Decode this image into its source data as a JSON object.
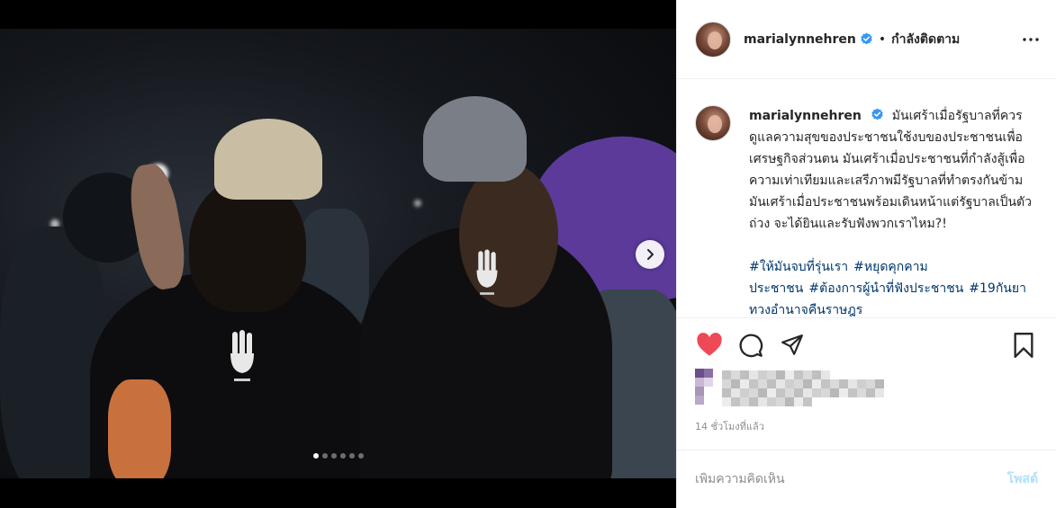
{
  "post": {
    "username": "marialynnehren",
    "follow_status": "กำลังติดตาม",
    "separator": "•",
    "caption": "มันเศร้าเมื่อรัฐบาลที่ควรดูแลความสุขของประชาชนใช้งบของประชาชนเพื่อเศรษฐกิจส่วนตน มันเศร้าเมื่อประชาชนที่กำลังสู้เพื่อความเท่าเทียมและเสรีภาพมีรัฐบาลที่ทำตรงกันข้าม มันเศร้าเมื่อประชาชนพร้อมเดินหน้าแต่รัฐบาลเป็นตัวถ่วง จะได้ยินและรับฟังพวกเราไหม?!",
    "hashtags": [
      "#ให้มันจบที่รุ่นเรา",
      "#หยุดคุกคามประชาชน",
      "#ต้องการผู้นำที่ฟังประชาชน",
      "#19กันยาทวงอำนาจคืนราษฎร"
    ],
    "timestamp": "14 ชั่วโมงที่แล้ว",
    "carousel": {
      "total_images": 6,
      "active_index": 0
    },
    "liked": true
  },
  "comment": {
    "placeholder": "เพิ่มความคิดเห็น",
    "post_label": "โพสต์"
  },
  "colors": {
    "like_red": "#ed4956",
    "link_blue": "#00376b",
    "verified_blue": "#3897f0",
    "post_disabled": "#b2dffc",
    "muted": "#8e8e8e"
  }
}
